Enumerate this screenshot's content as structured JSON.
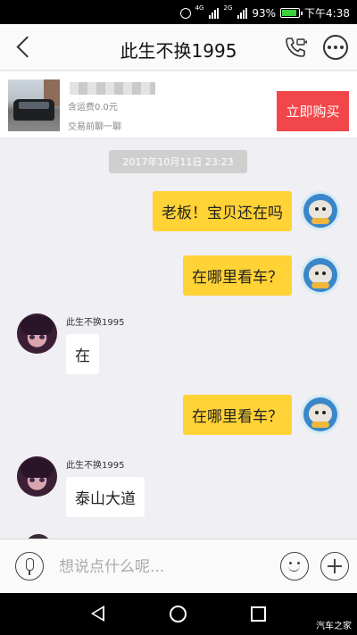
{
  "status_bar": {
    "network": "4G",
    "network2": "2G",
    "battery": "93%",
    "time": "下午4:38"
  },
  "header": {
    "title": "此生不换1995"
  },
  "product": {
    "shipping": "含运费0.0元",
    "chat_before": "交易前聊一聊",
    "buy_label": "立即购买"
  },
  "chat": {
    "timestamp": "2017年10月11日 23:23",
    "messages": [
      {
        "from": "me",
        "text": "老板！宝贝还在吗"
      },
      {
        "from": "me",
        "text": "在哪里看车？"
      },
      {
        "from": "other",
        "sender": "此生不换1995",
        "text": "在"
      },
      {
        "from": "me",
        "text": "在哪里看车？"
      },
      {
        "from": "other",
        "sender": "此生不换1995",
        "text": "泰山大道"
      }
    ]
  },
  "input": {
    "placeholder": "想说点什么呢..."
  },
  "watermark": "汽车之家",
  "colors": {
    "my_bubble": "#ffd235",
    "buy_button": "#f2474a",
    "timestamp_bg": "#cfcfcf",
    "chat_bg": "#efeff4"
  }
}
